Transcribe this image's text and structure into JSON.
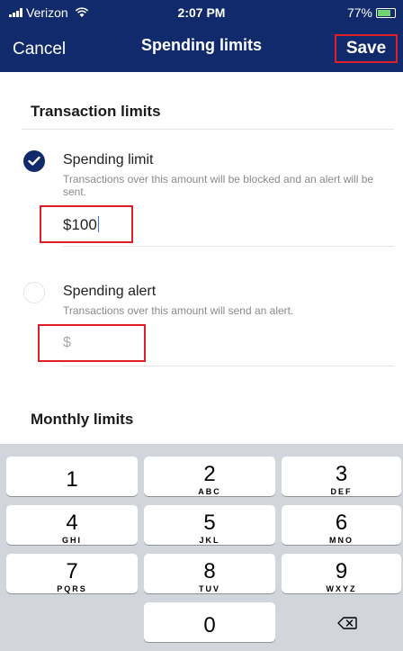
{
  "status_bar": {
    "carrier": "Verizon",
    "time": "2:07 PM",
    "battery": "77%"
  },
  "nav": {
    "cancel_label": "Cancel",
    "title": "Spending limits",
    "save_label": "Save"
  },
  "transaction_limits": {
    "title": "Transaction limits",
    "spending_limit": {
      "label": "Spending limit",
      "description": "Transactions over this amount will be blocked and an alert will be sent.",
      "value": "$100",
      "selected": true
    },
    "spending_alert": {
      "label": "Spending alert",
      "description": "Transactions over this amount will send an alert.",
      "placeholder": "$",
      "selected": false
    }
  },
  "monthly_limits": {
    "title": "Monthly limits"
  },
  "keypad": {
    "keys": [
      {
        "digit": "1",
        "letters": ""
      },
      {
        "digit": "2",
        "letters": "ABC"
      },
      {
        "digit": "3",
        "letters": "DEF"
      },
      {
        "digit": "4",
        "letters": "GHI"
      },
      {
        "digit": "5",
        "letters": "JKL"
      },
      {
        "digit": "6",
        "letters": "MNO"
      },
      {
        "digit": "7",
        "letters": "PQRS"
      },
      {
        "digit": "8",
        "letters": "TUV"
      },
      {
        "digit": "9",
        "letters": "WXYZ"
      },
      {
        "digit": "0",
        "letters": ""
      }
    ]
  },
  "colors": {
    "header": "#102a6b",
    "highlight": "#e01e25",
    "keypad_bg": "#d2d5db"
  }
}
